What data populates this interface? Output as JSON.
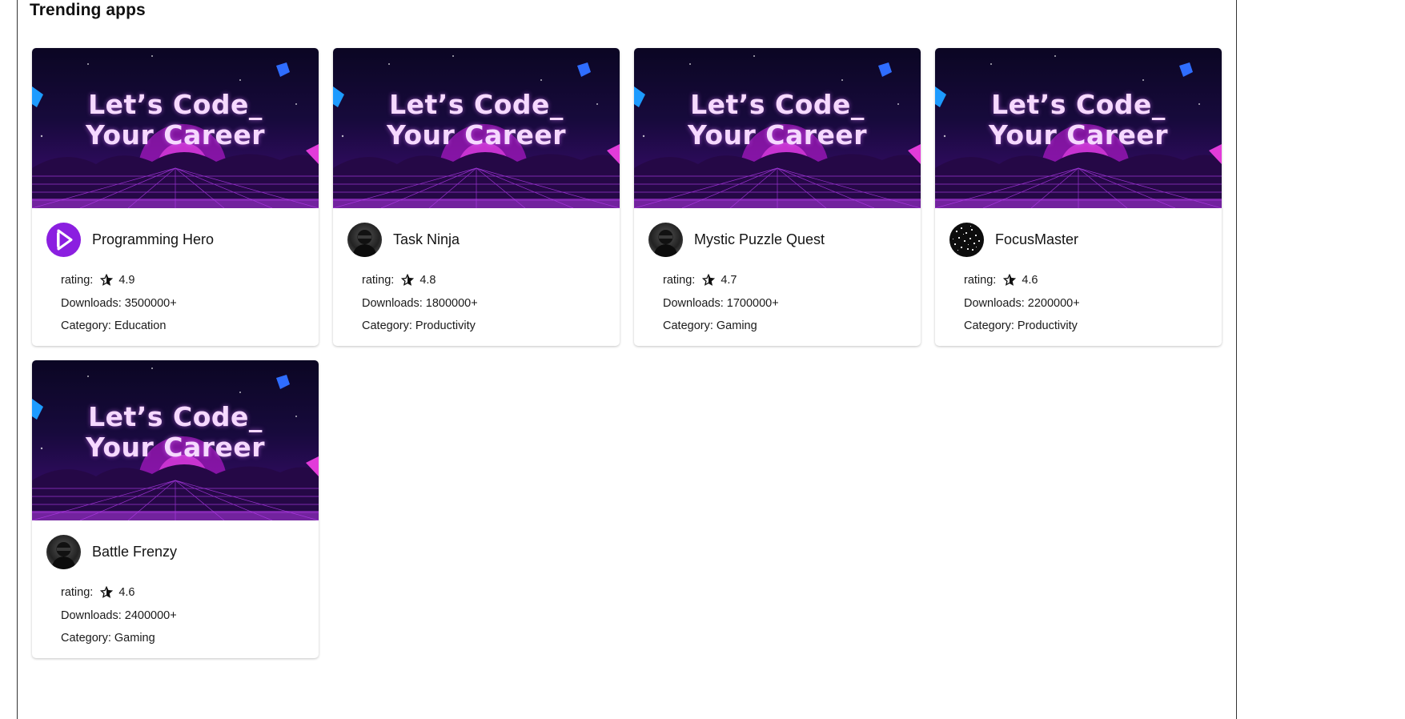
{
  "section": {
    "title": "Trending apps"
  },
  "banner_text": {
    "line1": "Let’s Code_",
    "line2": "Your Career"
  },
  "labels": {
    "rating": "rating:",
    "downloads": "Downloads:",
    "category": "Category:"
  },
  "apps": [
    {
      "name": "Programming Hero",
      "rating": "4.9",
      "downloads": "3500000+",
      "category": "Education",
      "icon": "programming-hero-logo"
    },
    {
      "name": "Task Ninja",
      "rating": "4.8",
      "downloads": "1800000+",
      "category": "Productivity",
      "icon": "ninja-avatar"
    },
    {
      "name": "Mystic Puzzle Quest",
      "rating": "4.7",
      "downloads": "1700000+",
      "category": "Gaming",
      "icon": "ninja-avatar"
    },
    {
      "name": "FocusMaster",
      "rating": "4.6",
      "downloads": "2200000+",
      "category": "Productivity",
      "icon": "noise-avatar"
    },
    {
      "name": "Battle Frenzy",
      "rating": "4.6",
      "downloads": "2400000+",
      "category": "Gaming",
      "icon": "ninja-avatar"
    }
  ],
  "colors": {
    "banner_dark": "#0b0623",
    "banner_purple": "#3b0c6d",
    "neon": "#d946ef",
    "hero_purple": "#8b1fe0"
  }
}
